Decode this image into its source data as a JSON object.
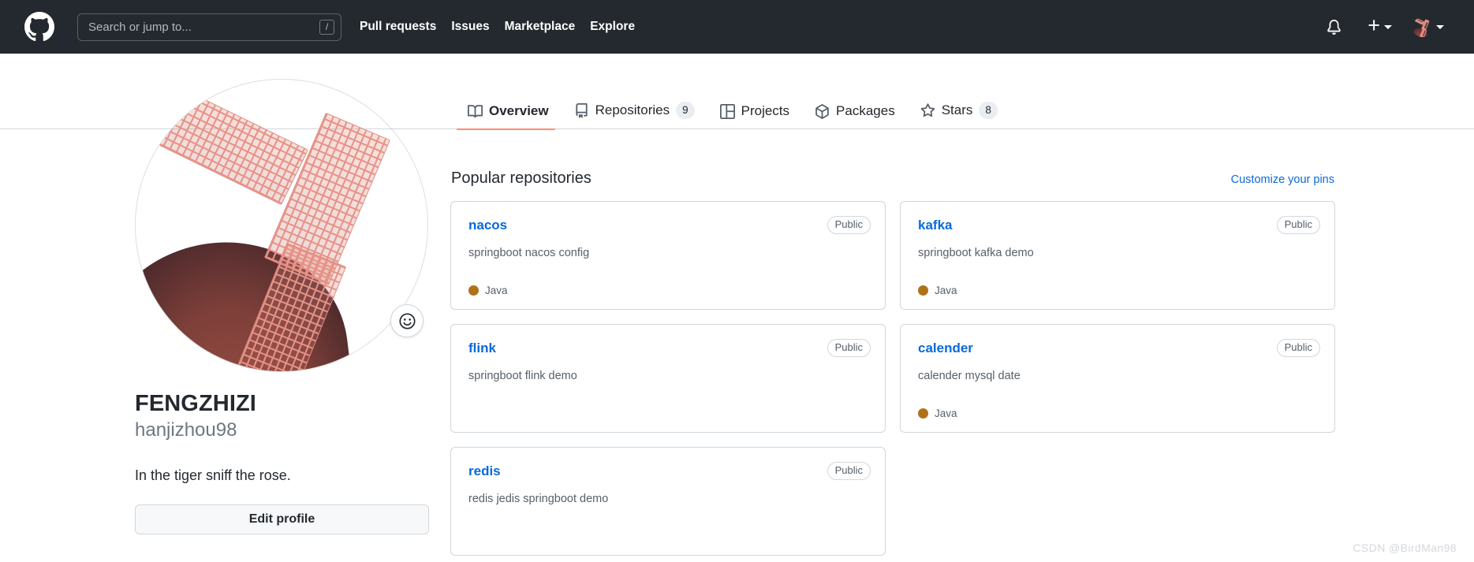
{
  "header": {
    "logo_icon": "github-mark-icon",
    "search": {
      "placeholder": "Search or jump to...",
      "value": "",
      "shortcut_key": "/"
    },
    "nav": [
      {
        "label": "Pull requests"
      },
      {
        "label": "Issues"
      },
      {
        "label": "Marketplace"
      },
      {
        "label": "Explore"
      }
    ],
    "notifications_icon": "bell-icon",
    "create_new_icon": "plus-icon",
    "create_new_caret_icon": "chevron-down-icon",
    "account_avatar": "avatar-windmill-image",
    "account_caret_icon": "chevron-down-icon",
    "background_color": "#24292f"
  },
  "profile": {
    "avatar_alt": "windmill-at-dusk-photo",
    "status_button_icon": "smiley-icon",
    "name": "FENGZHIZI",
    "login": "hanjizhou98",
    "bio": "In the tiger sniff the rose.",
    "edit_profile_label": "Edit profile"
  },
  "tabs": [
    {
      "label": "Overview",
      "icon": "book-icon",
      "count": null,
      "active": true
    },
    {
      "label": "Repositories",
      "icon": "repo-icon",
      "count": "9",
      "active": false
    },
    {
      "label": "Projects",
      "icon": "project-icon",
      "count": null,
      "active": false
    },
    {
      "label": "Packages",
      "icon": "package-icon",
      "count": null,
      "active": false
    },
    {
      "label": "Stars",
      "icon": "star-icon",
      "count": "8",
      "active": false
    }
  ],
  "popular": {
    "title": "Popular repositories",
    "customize_link": "Customize your pins",
    "repos": [
      {
        "name": "nacos",
        "visibility": "Public",
        "description": "springboot nacos config",
        "language": "Java",
        "language_color": "#b07219"
      },
      {
        "name": "kafka",
        "visibility": "Public",
        "description": "springboot kafka demo",
        "language": "Java",
        "language_color": "#b07219"
      },
      {
        "name": "flink",
        "visibility": "Public",
        "description": "springboot flink demo",
        "language": "",
        "language_color": ""
      },
      {
        "name": "calender",
        "visibility": "Public",
        "description": "calender mysql date",
        "language": "Java",
        "language_color": "#b07219"
      },
      {
        "name": "redis",
        "visibility": "Public",
        "description": "redis jedis springboot demo",
        "language": "",
        "language_color": ""
      }
    ]
  },
  "watermark": "CSDN @BirdMan98",
  "colors": {
    "accent_link": "#0969da",
    "active_tab_underline": "#fd8c73",
    "header_bg": "#24292f",
    "border": "#d0d7de"
  }
}
